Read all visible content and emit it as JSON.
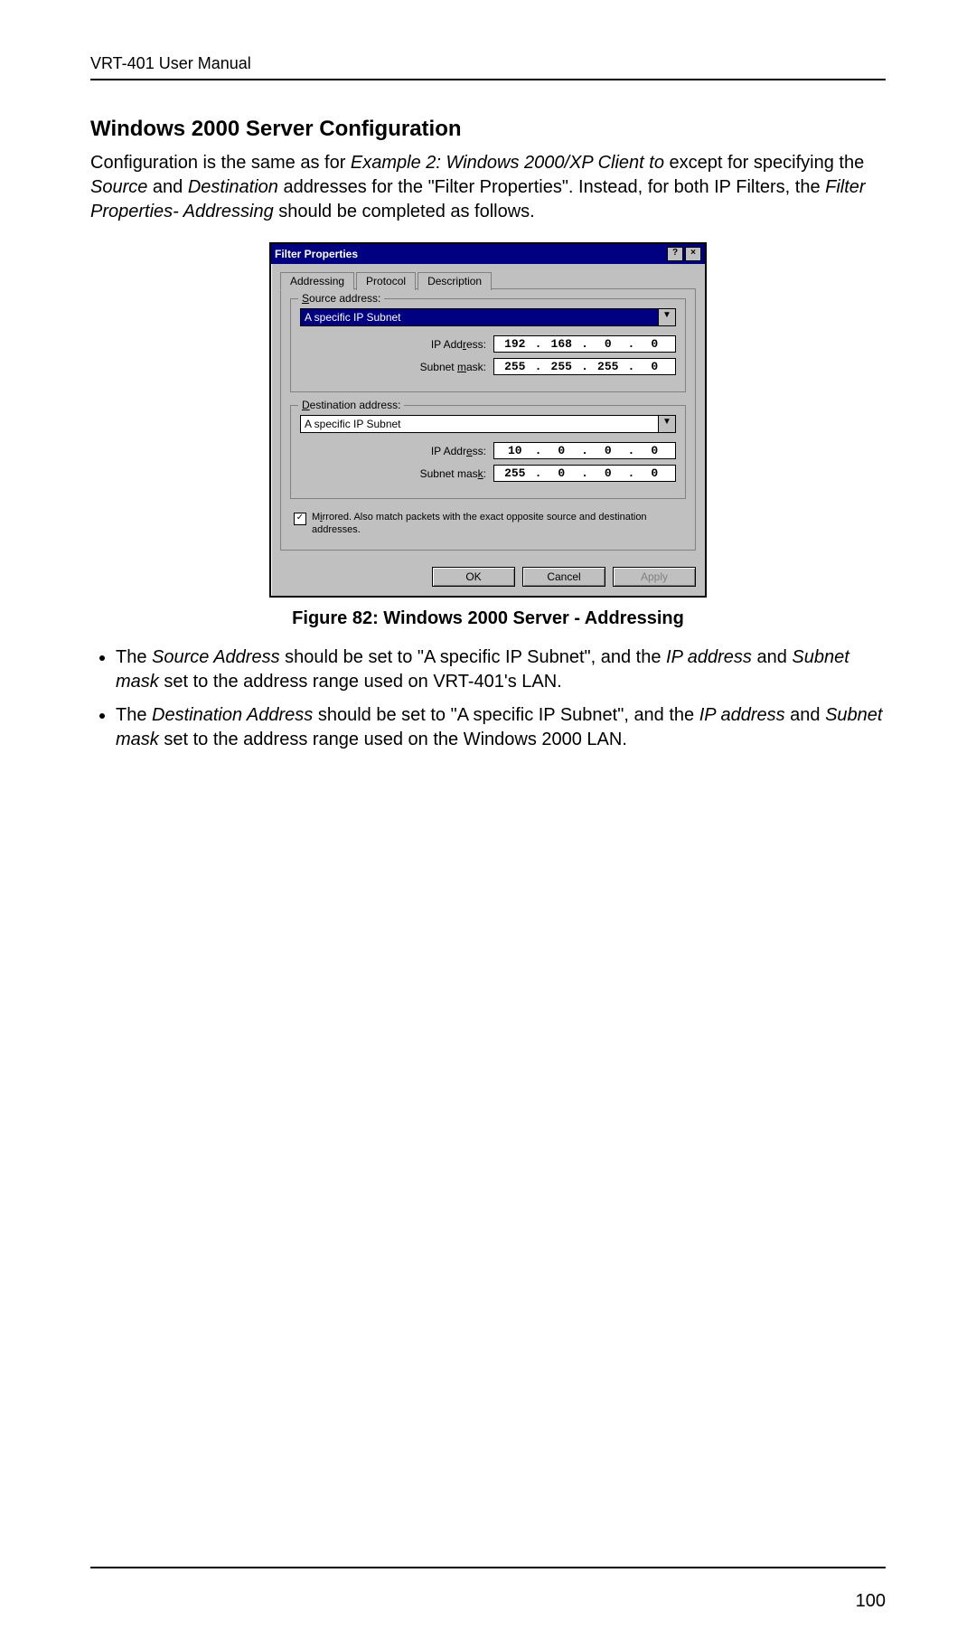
{
  "header": "VRT-401 User Manual",
  "page_number": "100",
  "heading": "Windows 2000 Server Configuration",
  "intro": {
    "p1a": "Configuration is the same as for ",
    "p1b": "Example 2:  Windows 2000/XP Client to ",
    "p1c": " except for specifying the ",
    "p1d": "Source",
    "p1e": " and ",
    "p1f": "Destination",
    "p1g": " addresses for the \"Filter Properties\". Instead, for both IP Filters, the ",
    "p1h": "Filter Properties- Addressing",
    "p1i": " should be completed as follows."
  },
  "dialog": {
    "title": "Filter Properties",
    "help_btn": "?",
    "close_btn": "×",
    "tabs": {
      "addressing": "Addressing",
      "protocol": "Protocol",
      "description": "Description"
    },
    "source": {
      "legend_pre": "S",
      "legend_rest": "ource address:",
      "dropdown": "A specific IP Subnet",
      "ip_label_pre": "IP Add",
      "ip_label_u": "r",
      "ip_label_post": "ess:",
      "ip": [
        "192",
        "168",
        "0",
        "0"
      ],
      "mask_label_pre": "Subnet ",
      "mask_label_u": "m",
      "mask_label_post": "ask:",
      "mask": [
        "255",
        "255",
        "255",
        "0"
      ]
    },
    "dest": {
      "legend_pre": "D",
      "legend_rest": "estination address:",
      "dropdown": "A specific IP Subnet",
      "ip_label_pre": "IP Addr",
      "ip_label_u": "e",
      "ip_label_post": "ss:",
      "ip": [
        "10",
        "0",
        "0",
        "0"
      ],
      "mask_label_pre": "Subnet mas",
      "mask_label_u": "k",
      "mask_label_post": ":",
      "mask": [
        "255",
        "0",
        "0",
        "0"
      ]
    },
    "mirrored_pre": "M",
    "mirrored_u": "i",
    "mirrored_rest": "rrored. Also match packets with the exact opposite source and destination addresses.",
    "checkmark": "✓",
    "buttons": {
      "ok": "OK",
      "cancel": "Cancel",
      "apply": "Apply"
    }
  },
  "figure_caption": "Figure 82: Windows 2000 Server - Addressing",
  "bullets": {
    "b1a": "The ",
    "b1b": "Source Address",
    "b1c": " should be set to \"A specific IP Subnet\", and the ",
    "b1d": "IP address",
    "b1e": " and ",
    "b1f": "Subnet mask",
    "b1g": " set to the address range used on VRT-401's LAN.",
    "b2a": "The ",
    "b2b": "Destination Address",
    "b2c": " should be set to \"A specific IP Subnet\", and the ",
    "b2d": "IP address",
    "b2e": " and ",
    "b2f": "Subnet mask",
    "b2g": " set to the address range used on the Windows 2000 LAN."
  }
}
